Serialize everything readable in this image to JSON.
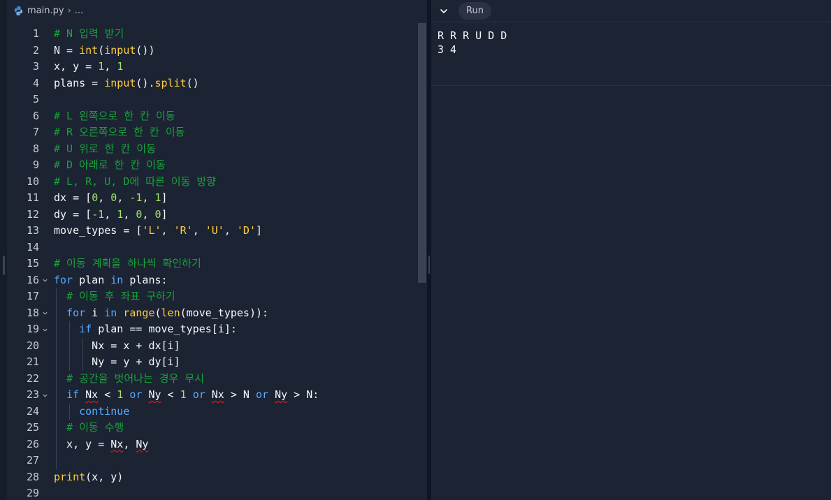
{
  "breadcrumb": {
    "file": "main.py",
    "separator": "›",
    "more": "..."
  },
  "run_label": "Run",
  "console_output": [
    "R R R U D D",
    "3 4"
  ],
  "code_lines": [
    {
      "n": "1",
      "fold": false,
      "guides": [],
      "tokens": [
        {
          "t": "# N 입력 받기",
          "c": "cm"
        }
      ]
    },
    {
      "n": "2",
      "fold": false,
      "guides": [],
      "tokens": [
        {
          "t": "N = ",
          "c": "op"
        },
        {
          "t": "int",
          "c": "fn"
        },
        {
          "t": "(",
          "c": "op"
        },
        {
          "t": "input",
          "c": "fn"
        },
        {
          "t": "())",
          "c": "op"
        }
      ]
    },
    {
      "n": "3",
      "fold": false,
      "guides": [],
      "tokens": [
        {
          "t": "x, y = ",
          "c": "op"
        },
        {
          "t": "1",
          "c": "num"
        },
        {
          "t": ", ",
          "c": "op"
        },
        {
          "t": "1",
          "c": "num"
        }
      ]
    },
    {
      "n": "4",
      "fold": false,
      "guides": [],
      "tokens": [
        {
          "t": "plans = ",
          "c": "op"
        },
        {
          "t": "input",
          "c": "fn"
        },
        {
          "t": "().",
          "c": "op"
        },
        {
          "t": "split",
          "c": "fn"
        },
        {
          "t": "()",
          "c": "op"
        }
      ]
    },
    {
      "n": "5",
      "fold": false,
      "guides": [],
      "tokens": []
    },
    {
      "n": "6",
      "fold": false,
      "guides": [],
      "tokens": [
        {
          "t": "# L 왼쪽으로 한 칸 이동",
          "c": "cm"
        }
      ]
    },
    {
      "n": "7",
      "fold": false,
      "guides": [],
      "tokens": [
        {
          "t": "# R 오른쪽으로 한 칸 이동",
          "c": "cm"
        }
      ]
    },
    {
      "n": "8",
      "fold": false,
      "guides": [],
      "tokens": [
        {
          "t": "# U 위로 한 칸 이동",
          "c": "cm"
        }
      ]
    },
    {
      "n": "9",
      "fold": false,
      "guides": [],
      "tokens": [
        {
          "t": "# D 아래로 한 칸 이동",
          "c": "cm"
        }
      ]
    },
    {
      "n": "10",
      "fold": false,
      "guides": [],
      "tokens": [
        {
          "t": "# L, R, U, D에 따른 이동 방향",
          "c": "cm"
        }
      ]
    },
    {
      "n": "11",
      "fold": false,
      "guides": [],
      "tokens": [
        {
          "t": "dx = [",
          "c": "op"
        },
        {
          "t": "0",
          "c": "num"
        },
        {
          "t": ", ",
          "c": "op"
        },
        {
          "t": "0",
          "c": "num"
        },
        {
          "t": ", ",
          "c": "op"
        },
        {
          "t": "-1",
          "c": "num"
        },
        {
          "t": ", ",
          "c": "op"
        },
        {
          "t": "1",
          "c": "num"
        },
        {
          "t": "]",
          "c": "op"
        }
      ]
    },
    {
      "n": "12",
      "fold": false,
      "guides": [],
      "tokens": [
        {
          "t": "dy = [",
          "c": "op"
        },
        {
          "t": "-1",
          "c": "num"
        },
        {
          "t": ", ",
          "c": "op"
        },
        {
          "t": "1",
          "c": "num"
        },
        {
          "t": ", ",
          "c": "op"
        },
        {
          "t": "0",
          "c": "num"
        },
        {
          "t": ", ",
          "c": "op"
        },
        {
          "t": "0",
          "c": "num"
        },
        {
          "t": "]",
          "c": "op"
        }
      ]
    },
    {
      "n": "13",
      "fold": false,
      "guides": [],
      "tokens": [
        {
          "t": "move_types = [",
          "c": "op"
        },
        {
          "t": "'L'",
          "c": "str"
        },
        {
          "t": ", ",
          "c": "op"
        },
        {
          "t": "'R'",
          "c": "str"
        },
        {
          "t": ", ",
          "c": "op"
        },
        {
          "t": "'U'",
          "c": "str"
        },
        {
          "t": ", ",
          "c": "op"
        },
        {
          "t": "'D'",
          "c": "str"
        },
        {
          "t": "]",
          "c": "op"
        }
      ]
    },
    {
      "n": "14",
      "fold": false,
      "guides": [],
      "tokens": []
    },
    {
      "n": "15",
      "fold": false,
      "guides": [],
      "tokens": [
        {
          "t": "# 이동 계획을 하나씩 확인하기",
          "c": "cm"
        }
      ]
    },
    {
      "n": "16",
      "fold": true,
      "guides": [],
      "tokens": [
        {
          "t": "for",
          "c": "kw"
        },
        {
          "t": " plan ",
          "c": "op"
        },
        {
          "t": "in",
          "c": "kw"
        },
        {
          "t": " plans:",
          "c": "op"
        }
      ]
    },
    {
      "n": "17",
      "fold": false,
      "guides": [
        0
      ],
      "tokens": [
        {
          "t": "  ",
          "c": "op"
        },
        {
          "t": "# 이동 후 좌표 구하기",
          "c": "cm"
        }
      ]
    },
    {
      "n": "18",
      "fold": true,
      "guides": [
        0
      ],
      "tokens": [
        {
          "t": "  ",
          "c": "op"
        },
        {
          "t": "for",
          "c": "kw"
        },
        {
          "t": " i ",
          "c": "op"
        },
        {
          "t": "in",
          "c": "kw"
        },
        {
          "t": " ",
          "c": "op"
        },
        {
          "t": "range",
          "c": "fn"
        },
        {
          "t": "(",
          "c": "op"
        },
        {
          "t": "len",
          "c": "fn"
        },
        {
          "t": "(move_types)):",
          "c": "op"
        }
      ]
    },
    {
      "n": "19",
      "fold": true,
      "guides": [
        0,
        1
      ],
      "tokens": [
        {
          "t": "    ",
          "c": "op"
        },
        {
          "t": "if",
          "c": "kw"
        },
        {
          "t": " plan == move_types[i]:",
          "c": "op"
        }
      ]
    },
    {
      "n": "20",
      "fold": false,
      "guides": [
        0,
        1,
        2
      ],
      "tokens": [
        {
          "t": "      Nx = x + dx[i]",
          "c": "op"
        }
      ]
    },
    {
      "n": "21",
      "fold": false,
      "guides": [
        0,
        1,
        2
      ],
      "tokens": [
        {
          "t": "      Ny = y + dy[i]",
          "c": "op"
        }
      ]
    },
    {
      "n": "22",
      "fold": false,
      "guides": [
        0
      ],
      "tokens": [
        {
          "t": "  ",
          "c": "op"
        },
        {
          "t": "# 공간을 벗어나는 경우 무시",
          "c": "cm"
        }
      ]
    },
    {
      "n": "23",
      "fold": true,
      "guides": [
        0
      ],
      "tokens": [
        {
          "t": "  ",
          "c": "op"
        },
        {
          "t": "if",
          "c": "kw"
        },
        {
          "t": " ",
          "c": "op"
        },
        {
          "t": "Nx",
          "c": "op sq"
        },
        {
          "t": " < ",
          "c": "op"
        },
        {
          "t": "1",
          "c": "num"
        },
        {
          "t": " ",
          "c": "op"
        },
        {
          "t": "or",
          "c": "kw"
        },
        {
          "t": " ",
          "c": "op"
        },
        {
          "t": "Ny",
          "c": "op sq"
        },
        {
          "t": " < ",
          "c": "op"
        },
        {
          "t": "1",
          "c": "num"
        },
        {
          "t": " ",
          "c": "op"
        },
        {
          "t": "or",
          "c": "kw"
        },
        {
          "t": " ",
          "c": "op"
        },
        {
          "t": "Nx",
          "c": "op sq"
        },
        {
          "t": " > N ",
          "c": "op"
        },
        {
          "t": "or",
          "c": "kw"
        },
        {
          "t": " ",
          "c": "op"
        },
        {
          "t": "Ny",
          "c": "op sq"
        },
        {
          "t": " > N:",
          "c": "op"
        }
      ]
    },
    {
      "n": "24",
      "fold": false,
      "guides": [
        0,
        1
      ],
      "tokens": [
        {
          "t": "    ",
          "c": "op"
        },
        {
          "t": "continue",
          "c": "kw"
        }
      ]
    },
    {
      "n": "25",
      "fold": false,
      "guides": [
        0
      ],
      "tokens": [
        {
          "t": "  ",
          "c": "op"
        },
        {
          "t": "# 이동 수행",
          "c": "cm"
        }
      ]
    },
    {
      "n": "26",
      "fold": false,
      "guides": [
        0
      ],
      "tokens": [
        {
          "t": "  x, y = ",
          "c": "op"
        },
        {
          "t": "Nx",
          "c": "op sq"
        },
        {
          "t": ", ",
          "c": "op"
        },
        {
          "t": "Ny",
          "c": "op sq"
        }
      ]
    },
    {
      "n": "27",
      "fold": false,
      "guides": [
        0
      ],
      "tokens": []
    },
    {
      "n": "28",
      "fold": false,
      "guides": [],
      "tokens": [
        {
          "t": "print",
          "c": "fn"
        },
        {
          "t": "(x, y)",
          "c": "op"
        }
      ]
    },
    {
      "n": "29",
      "fold": false,
      "guides": [],
      "tokens": []
    }
  ]
}
